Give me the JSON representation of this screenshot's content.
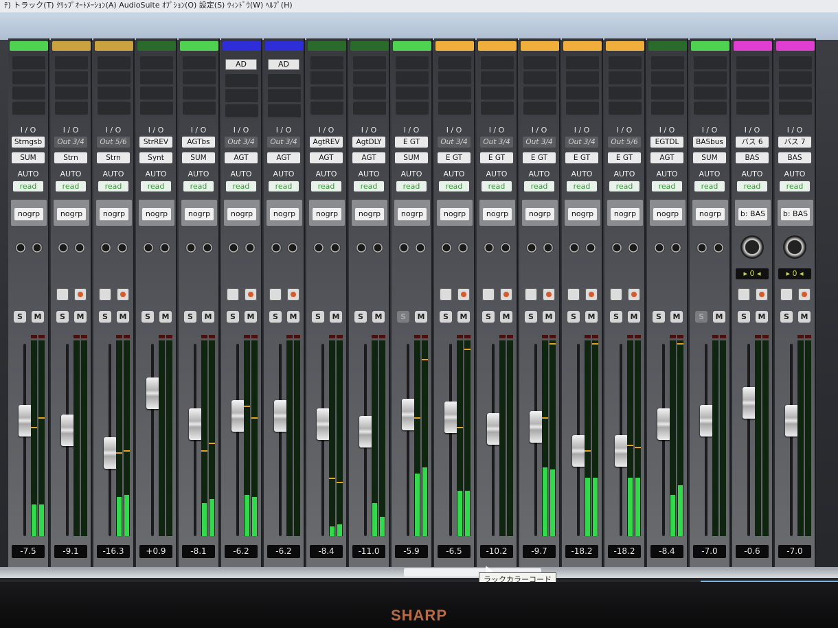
{
  "menubar": {
    "text": "ﾃ) トラック(T) ｸﾘｯﾌﾟｵｰﾄﾒｰｼｮﾝ(A) AudioSuite ｵﾌﾟｼｮﾝ(O) 設定(S) ｳｨﾝﾄﾞｳ(W) ﾍﾙﾌﾟ(H)"
  },
  "io_label": "I / O",
  "auto_label": "AUTO",
  "read_label": "read",
  "solo_label": "S",
  "mute_label": "M",
  "tooltip": "ラックカラーコード",
  "brand": "SHARP",
  "strips": [
    {
      "color": "#4fd24f",
      "input": "Strngsb",
      "input_active": true,
      "output": "SUM",
      "group": "nogrp",
      "volume": "-7.5",
      "fader": 0.62,
      "meterL": 0.16,
      "meterR": 0.16,
      "peakL": 0.55,
      "peakR": 0.6,
      "has_ir": false,
      "insert": "",
      "solo_dim": false,
      "bus_knob": false
    },
    {
      "color": "#caa23e",
      "input": "Out 3/4",
      "input_active": false,
      "output": "Strn",
      "group": "nogrp",
      "volume": "-9.1",
      "fader": 0.56,
      "meterL": 0.0,
      "meterR": 0.0,
      "peakL": 0.0,
      "peakR": 0.0,
      "has_ir": true,
      "insert": "",
      "solo_dim": false,
      "bus_knob": false
    },
    {
      "color": "#caa23e",
      "input": "Out 5/6",
      "input_active": false,
      "output": "Strn",
      "group": "nogrp",
      "volume": "-16.3",
      "fader": 0.42,
      "meterL": 0.2,
      "meterR": 0.21,
      "peakL": 0.42,
      "peakR": 0.43,
      "has_ir": true,
      "insert": "",
      "solo_dim": false,
      "bus_knob": false
    },
    {
      "color": "#2a6a2a",
      "input": "StrREV",
      "input_active": true,
      "output": "Synt",
      "group": "nogrp",
      "volume": "+0.9",
      "fader": 0.79,
      "meterL": 0.0,
      "meterR": 0.0,
      "peakL": 0.0,
      "peakR": 0.0,
      "has_ir": false,
      "insert": "",
      "solo_dim": false,
      "bus_knob": false
    },
    {
      "color": "#4fd24f",
      "input": "AGTbs",
      "input_active": true,
      "output": "SUM",
      "group": "nogrp",
      "volume": "-8.1",
      "fader": 0.6,
      "meterL": 0.17,
      "meterR": 0.19,
      "peakL": 0.43,
      "peakR": 0.47,
      "has_ir": false,
      "insert": "",
      "solo_dim": false,
      "bus_knob": false
    },
    {
      "color": "#2e2ed8",
      "input": "Out 3/4",
      "input_active": false,
      "output": "AGT",
      "group": "nogrp",
      "volume": "-6.2",
      "fader": 0.65,
      "meterL": 0.21,
      "meterR": 0.2,
      "peakL": 0.66,
      "peakR": 0.6,
      "has_ir": true,
      "insert": "AD",
      "solo_dim": false,
      "bus_knob": false
    },
    {
      "color": "#2e2ed8",
      "input": "Out 3/4",
      "input_active": false,
      "output": "AGT",
      "group": "nogrp",
      "volume": "-6.2",
      "fader": 0.65,
      "meterL": 0.0,
      "meterR": 0.0,
      "peakL": 0.0,
      "peakR": 0.0,
      "has_ir": true,
      "insert": "AD",
      "solo_dim": false,
      "bus_knob": false
    },
    {
      "color": "#2a6a2a",
      "input": "AgtREV",
      "input_active": true,
      "output": "AGT",
      "group": "nogrp",
      "volume": "-8.4",
      "fader": 0.6,
      "meterL": 0.05,
      "meterR": 0.06,
      "peakL": 0.29,
      "peakR": 0.27,
      "has_ir": false,
      "insert": "",
      "solo_dim": false,
      "bus_knob": false
    },
    {
      "color": "#2a6a2a",
      "input": "AgtDLY",
      "input_active": true,
      "output": "AGT",
      "group": "nogrp",
      "volume": "-11.0",
      "fader": 0.55,
      "meterL": 0.17,
      "meterR": 0.1,
      "peakL": 0.0,
      "peakR": 0.0,
      "has_ir": false,
      "insert": "",
      "solo_dim": false,
      "bus_knob": false
    },
    {
      "color": "#4fd24f",
      "input": "E GT",
      "input_active": true,
      "output": "SUM",
      "group": "nogrp",
      "volume": "-5.9",
      "fader": 0.66,
      "meterL": 0.32,
      "meterR": 0.35,
      "peakL": 0.6,
      "peakR": 0.9,
      "has_ir": false,
      "insert": "",
      "solo_dim": true,
      "bus_knob": false
    },
    {
      "color": "#f0ae3a",
      "input": "Out 3/4",
      "input_active": false,
      "output": "E GT",
      "group": "nogrp",
      "volume": "-6.5",
      "fader": 0.64,
      "meterL": 0.23,
      "meterR": 0.23,
      "peakL": 0.55,
      "peakR": 0.95,
      "has_ir": true,
      "insert": "",
      "solo_dim": false,
      "bus_knob": false
    },
    {
      "color": "#f0ae3a",
      "input": "Out 3/4",
      "input_active": false,
      "output": "E GT",
      "group": "nogrp",
      "volume": "-10.2",
      "fader": 0.57,
      "meterL": 0.0,
      "meterR": 0.0,
      "peakL": 0.0,
      "peakR": 0.0,
      "has_ir": true,
      "insert": "",
      "solo_dim": false,
      "bus_knob": false
    },
    {
      "color": "#f0ae3a",
      "input": "Out 3/4",
      "input_active": false,
      "output": "E GT",
      "group": "nogrp",
      "volume": "-9.7",
      "fader": 0.58,
      "meterL": 0.35,
      "meterR": 0.34,
      "peakL": 0.6,
      "peakR": 0.98,
      "has_ir": true,
      "insert": "",
      "solo_dim": false,
      "bus_knob": false
    },
    {
      "color": "#f0ae3a",
      "input": "Out 3/4",
      "input_active": false,
      "output": "E GT",
      "group": "nogrp",
      "volume": "-18.2",
      "fader": 0.43,
      "meterL": 0.3,
      "meterR": 0.3,
      "peakL": 0.43,
      "peakR": 0.98,
      "has_ir": true,
      "insert": "",
      "solo_dim": false,
      "bus_knob": false
    },
    {
      "color": "#f0ae3a",
      "input": "Out 5/6",
      "input_active": false,
      "output": "E GT",
      "group": "nogrp",
      "volume": "-18.2",
      "fader": 0.43,
      "meterL": 0.3,
      "meterR": 0.3,
      "peakL": 0.46,
      "peakR": 0.45,
      "has_ir": true,
      "insert": "",
      "solo_dim": false,
      "bus_knob": false
    },
    {
      "color": "#2a6a2a",
      "input": "EGTDL",
      "input_active": true,
      "output": "AGT",
      "group": "nogrp",
      "volume": "-8.4",
      "fader": 0.6,
      "meterL": 0.21,
      "meterR": 0.26,
      "peakL": 0.0,
      "peakR": 0.98,
      "has_ir": false,
      "insert": "",
      "solo_dim": false,
      "bus_knob": false
    },
    {
      "color": "#4fd24f",
      "input": "BASbus",
      "input_active": true,
      "output": "SUM",
      "group": "nogrp",
      "volume": "-7.0",
      "fader": 0.62,
      "meterL": 0.0,
      "meterR": 0.0,
      "peakL": 0.0,
      "peakR": 0.0,
      "has_ir": false,
      "insert": "",
      "solo_dim": true,
      "bus_knob": false
    },
    {
      "color": "#e03ed0",
      "input": "バス 6",
      "input_active": true,
      "output": "BAS",
      "group": "b: BAS",
      "volume": "-0.6",
      "fader": 0.73,
      "meterL": 0.0,
      "meterR": 0.0,
      "peakL": 0.0,
      "peakR": 0.0,
      "has_ir": true,
      "insert": "",
      "solo_dim": false,
      "bus_knob": true,
      "pan": "▸ 0 ◂"
    },
    {
      "color": "#e03ed0",
      "input": "バス 7",
      "input_active": true,
      "output": "BAS",
      "group": "b: BAS",
      "volume": "-7.0",
      "fader": 0.62,
      "meterL": 0.0,
      "meterR": 0.0,
      "peakL": 0.0,
      "peakR": 0.0,
      "has_ir": true,
      "insert": "",
      "solo_dim": false,
      "bus_knob": true,
      "pan": "▸ 0 ◂"
    }
  ]
}
